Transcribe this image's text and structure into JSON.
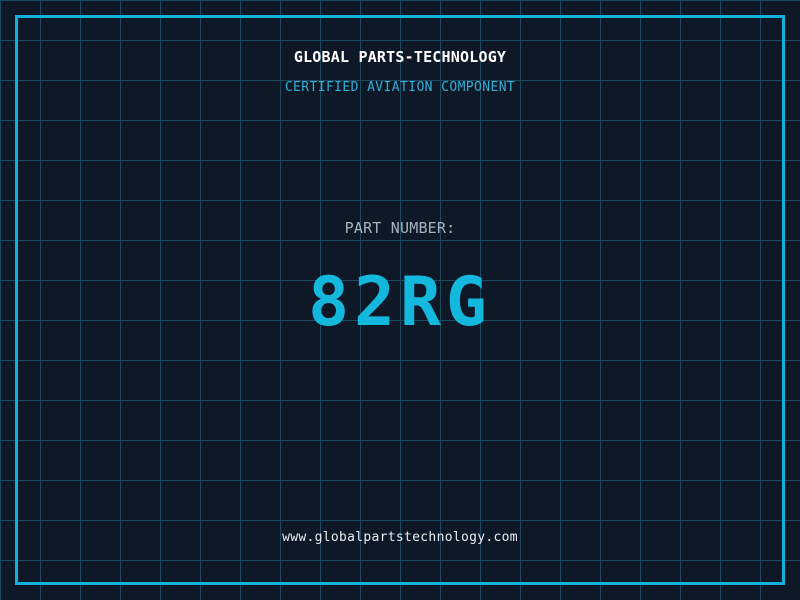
{
  "header": {
    "title": "GLOBAL PARTS-TECHNOLOGY",
    "subtitle": "CERTIFIED AVIATION COMPONENT"
  },
  "part": {
    "label": "PART NUMBER:",
    "number": "82RG"
  },
  "footer": {
    "url": "www.globalpartstechnology.com"
  },
  "colors": {
    "background": "#0f1827",
    "grid_line": "#1c4a61",
    "frame": "#13b1d9",
    "title": "#ffffff",
    "subtitle": "#35aed6",
    "part_label": "#a9b3be",
    "part_number": "#14b8dd",
    "footer_text": "#e9eef3"
  }
}
